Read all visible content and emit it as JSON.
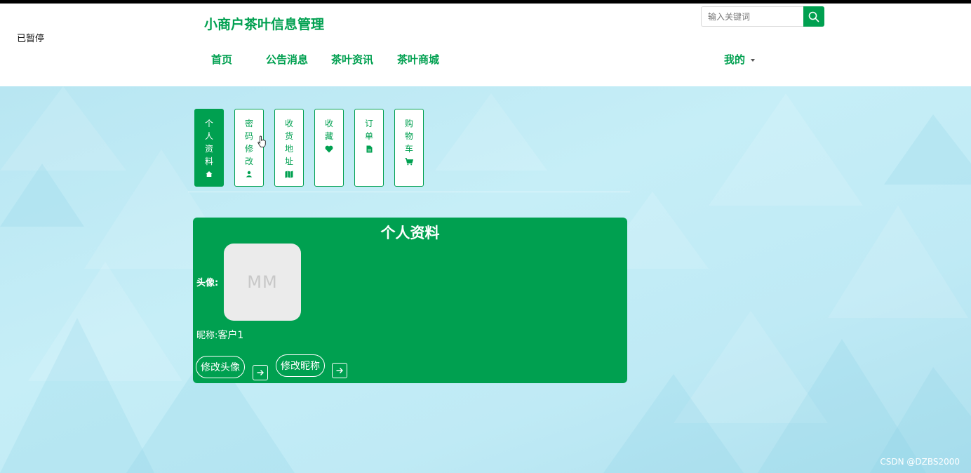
{
  "status_overlay": "已暂停",
  "header": {
    "site_title": "小商户茶叶信息管理",
    "search_placeholder": "输入关键词",
    "nav": [
      "首页",
      "公告消息",
      "茶叶资讯",
      "茶叶商城"
    ],
    "mine_label": "我的"
  },
  "side_tabs": [
    {
      "label": "个人资料",
      "icon": "home-icon",
      "active": true
    },
    {
      "label": "密码修改",
      "icon": "user-icon",
      "active": false
    },
    {
      "label": "收货地址",
      "icon": "map-icon",
      "active": false
    },
    {
      "label": "收藏",
      "icon": "heart-icon",
      "active": false
    },
    {
      "label": "订单",
      "icon": "file-icon",
      "active": false
    },
    {
      "label": "购物车",
      "icon": "cart-icon",
      "active": false
    }
  ],
  "profile": {
    "title": "个人资料",
    "avatar_label": "头像:",
    "avatar_initials": "MM",
    "nickname_label": "昵称:",
    "nickname_value": "客户1",
    "change_avatar_label": "修改头像",
    "change_nickname_label": "修改昵称"
  },
  "watermark": "CSDN @DZBS2000",
  "colors": {
    "accent": "#00a050",
    "background": "#c3ecf6",
    "avatar_bg": "#ebebeb"
  }
}
